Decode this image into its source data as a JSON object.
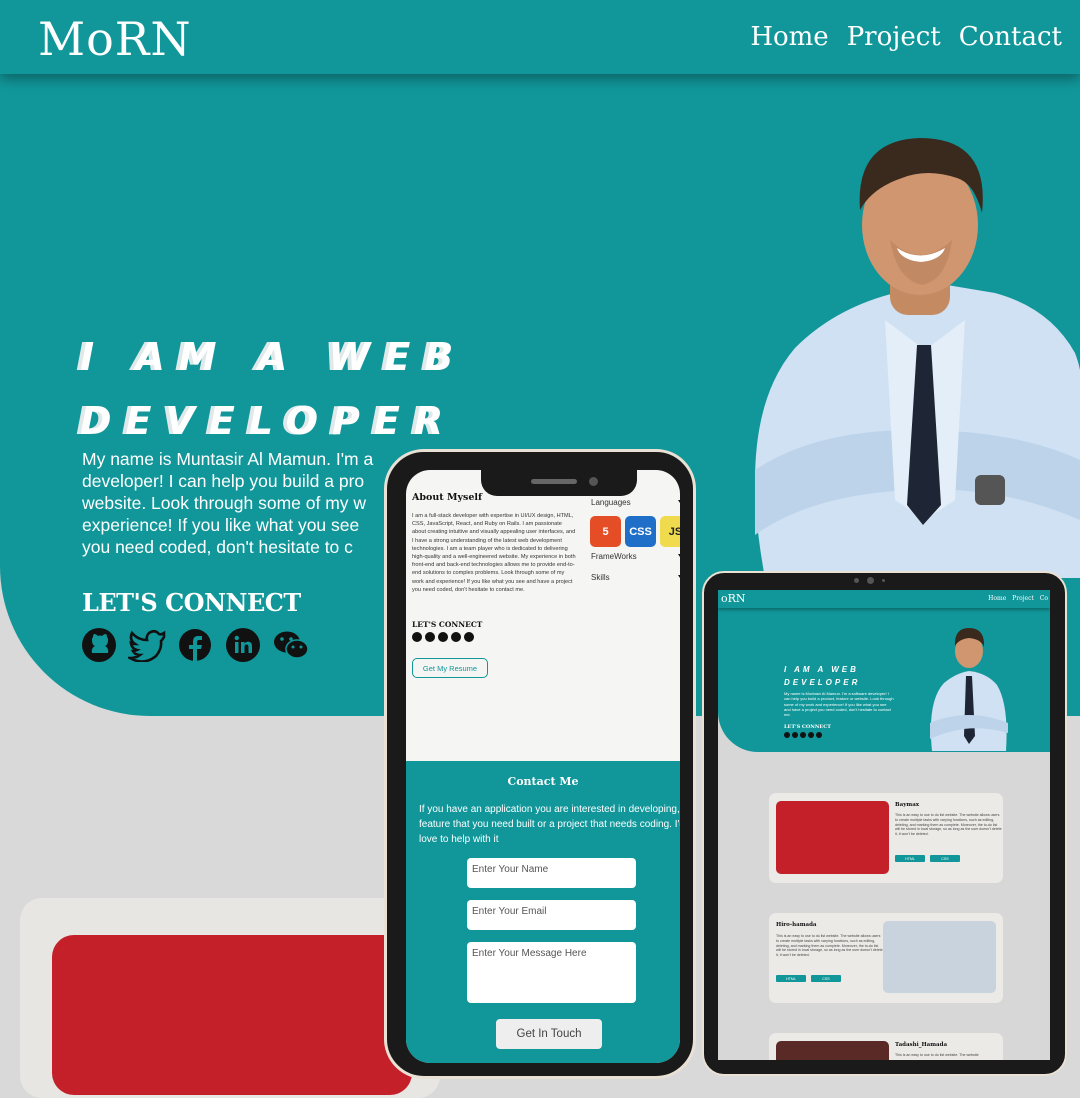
{
  "header": {
    "logo": "MoRN",
    "nav": [
      "Home",
      "Project",
      "Contact"
    ]
  },
  "hero": {
    "headline_line1": "I AM A WEB",
    "headline_line2": "DEVELOPER",
    "intro_lines": [
      "My name is Muntasir Al Mamun. I'm a",
      "developer! I can help you build a pro",
      "website. Look through some of my w",
      "experience! If you like what you see",
      "you need coded, don't hesitate to c"
    ],
    "connect_title": "LET'S CONNECT",
    "socials": [
      "github-icon",
      "twitter-icon",
      "facebook-icon",
      "linkedin-icon",
      "wechat-icon"
    ]
  },
  "phone": {
    "about_title": "About Myself",
    "about_text": "I am a full-stack developer with expertise in UI/UX design, HTML, CSS, JavaScript, React, and Ruby on Rails. I am passionate about creating intuitive and visually appealing user interfaces, and I have a strong understanding of the latest web development technologies. I am a team player who is dedicated to delivering high-quality and a well-engineered website. My experience in both front-end and back-end technologies allows me to provide end-to-end solutions to complex problems. Look through some of my work and experience! If you like what you see and have a project you need coded, don't hesitate to contact me.",
    "languages_label": "Languages",
    "lang_icons": [
      "5",
      "CSS",
      "JS"
    ],
    "frameworks_label": "FrameWorks",
    "skills_label": "Skills",
    "connect_title": "LET'S CONNECT",
    "resume_button": "Get My Resume",
    "contact_title": "Contact Me",
    "contact_text_lines": [
      "If you have an application you are interested in developing, a",
      "feature that you need built or a project that needs coding. I'd",
      "love to help with it"
    ],
    "name_placeholder": "Enter Your Name",
    "email_placeholder": "Enter Your Email",
    "message_placeholder": "Enter Your Message Here",
    "submit_button": "Get In Touch"
  },
  "tablet": {
    "logo": "oRN",
    "nav": [
      "Home",
      "Project",
      "Co"
    ],
    "headline_line1": "I AM A WEB",
    "headline_line2": "DEVELOPER",
    "intro": "My name is Muntasir Al Mamun. I'm a software developer! I can help you build a product, feature or website. Look through some of my work and experience! If you like what you see and have a project you need coded, don't hesitate to contact me.",
    "connect_title": "LET'S CONNECT",
    "projects": [
      {
        "title": "Baymax",
        "text": "This is an easy to use to do list website. The website allows users to create multiple tasks with varying functions, such as editing, deleting, and marking them as complete. Moreover, the to-do list will be stored in local storage, so as long as the user doesn't delete it, it won't be deleted.",
        "tags": [
          "HTML",
          "CSS"
        ]
      },
      {
        "title": "Hiro-hamada",
        "text": "This is an easy to use to do list website. The website allows users to create multiple tasks with varying functions, such as editing, deleting, and marking them as complete. Moreover, the to-do list will be stored in local storage, so as long as the user doesn't delete it, it won't be deleted.",
        "tags": [
          "HTML",
          "CSS"
        ]
      },
      {
        "title": "Tadashi_Hamada",
        "text": "This is an easy to use to do list website. The website",
        "tags": []
      }
    ]
  },
  "colors": {
    "teal": "#11979a",
    "background": "#d9d9d9",
    "red": "#c4202a"
  }
}
